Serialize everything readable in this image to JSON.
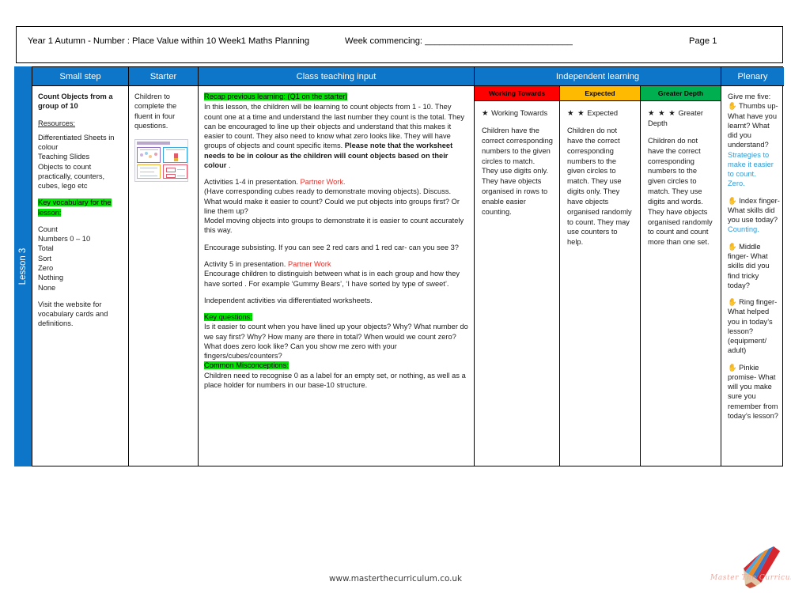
{
  "header": {
    "title": "Year 1 Autumn -  Number : Place Value within 10 Week1 Maths Planning",
    "week_commencing": "Week commencing: ______________________________",
    "page": "Page 1"
  },
  "lesson_tab": {
    "label": "Lesson 3"
  },
  "columns": {
    "small_step": "Small step",
    "starter": "Starter",
    "class_teaching_input": "Class teaching input",
    "independent_learning": "Independent learning",
    "plenary": "Plenary"
  },
  "small_step": {
    "heading": "Count Objects from a group of 10",
    "resources_label": "Resources:",
    "resources": "Differentiated Sheets in colour\nTeaching Slides\nObjects to count practically, counters, cubes, lego etc",
    "vocab_heading": "Key vocabulary for the lesson:",
    "vocab_words": "Count\nNumbers 0 – 10\nTotal\nSort\nZero\nNothing\nNone",
    "website_note": "Visit the website for vocabulary cards and definitions."
  },
  "starter": {
    "text": "Children to complete the fluent in four questions.",
    "thumbnail_name": "fluent-in-four-slide-thumbnail"
  },
  "class_teaching_input": {
    "recap_heading": "Recap previous learning: (Q1 on the starter)",
    "recap_body_1": "In this lesson, the children will be learning to count objects from 1 - 10. They count one at a time and understand the last number they count is the total. They can be encouraged to line up their objects and understand that this makes it easier to count. They also need to know what zero looks like. They will have groups of objects and count specific items. ",
    "recap_body_bold": "Please note that the worksheet needs to be in colour as the children will count objects based on their colour",
    "recap_body_end": " .",
    "activities_1_4": "Activities 1-4 in presentation. ",
    "partner_work_1": "Partner Work.",
    "activities_1_4_body": "(Have corresponding cubes ready to demonstrate moving objects). Discuss. What would make it easier to count? Could we put objects into groups first? Or line them up?\nModel moving objects into groups to demonstrate it is easier to count accurately this way.",
    "subsisting": "Encourage subsisting. If you can see 2 red cars and 1 red car- can you see 3?",
    "activity_5": "Activity 5 in presentation. ",
    "partner_work_2": "Partner Work",
    "activity_5_body": "Encourage children to distinguish between what is in each group and how they have sorted . For example ‘Gummy Bears’, ‘I have sorted by type of sweet’.",
    "independent_activities": "Independent activities via differentiated worksheets.",
    "key_questions_heading": "Key questions:",
    "key_questions_body": "Is it easier to count when you have lined up your objects? Why? What number do we say first? Why? How many are there in total? When would we count zero? What does zero look like? Can you show me zero with your fingers/cubes/counters?",
    "misconceptions_heading": "Common Misconceptions:",
    "misconceptions_body": "Children need to recognise 0 as a label for an empty set, or nothing, as well as a place holder for numbers in our base-10 structure."
  },
  "independent_learning": {
    "levels": [
      {
        "badge": "Working Towards",
        "badge_color": "#ff0000",
        "stars": "★",
        "star_label": "Working Towards",
        "body": "Children have the correct corresponding numbers to the given circles to match. They use digits only. They have objects organised in rows to enable easier counting."
      },
      {
        "badge": "Expected",
        "badge_color": "#fdba00",
        "stars": "★ ★",
        "star_label": "Expected",
        "body": "Children do not have the correct corresponding numbers to the given circles to match. They use digits only. They have objects organised randomly to count. They may use counters to help."
      },
      {
        "badge": "Greater Depth",
        "badge_color": "#00b050",
        "stars": "★ ★ ★",
        "star_label": "Greater Depth",
        "body": "Children do not have the correct corresponding numbers to the given circles to match. They use digits and words. They have objects organised randomly to count and count more than one set."
      }
    ]
  },
  "plenary": {
    "intro": "Give me five:",
    "items": [
      {
        "icon": "hand-icon",
        "text": " Thumbs up- What have you learnt? What did you understand?",
        "answer": "Strategies to make it easier to count.\nZero."
      },
      {
        "icon": "hand-icon",
        "text": " Index finger- What skills did you use today?",
        "answer": "Counting."
      },
      {
        "icon": "hand-icon",
        "text": " Middle finger- What skills did you find tricky today?",
        "answer": ""
      },
      {
        "icon": "hand-icon",
        "text": " Ring finger- What helped you in today’s lesson? (equipment/ adult)",
        "answer": ""
      },
      {
        "icon": "hand-icon",
        "text": " Pinkie promise- What will you make sure you remember from today’s lesson?",
        "answer": ""
      }
    ]
  },
  "footer": {
    "url": "www.masterthecurriculum.co.uk",
    "logo_text": "Master The Curriculum",
    "logo_name": "master-the-curriculum-pencil-logo"
  },
  "colors": {
    "brand_blue": "#0d76c9",
    "highlight_green": "#00e500",
    "red": "#e8302a",
    "blue_answer": "#2e9bd6"
  }
}
